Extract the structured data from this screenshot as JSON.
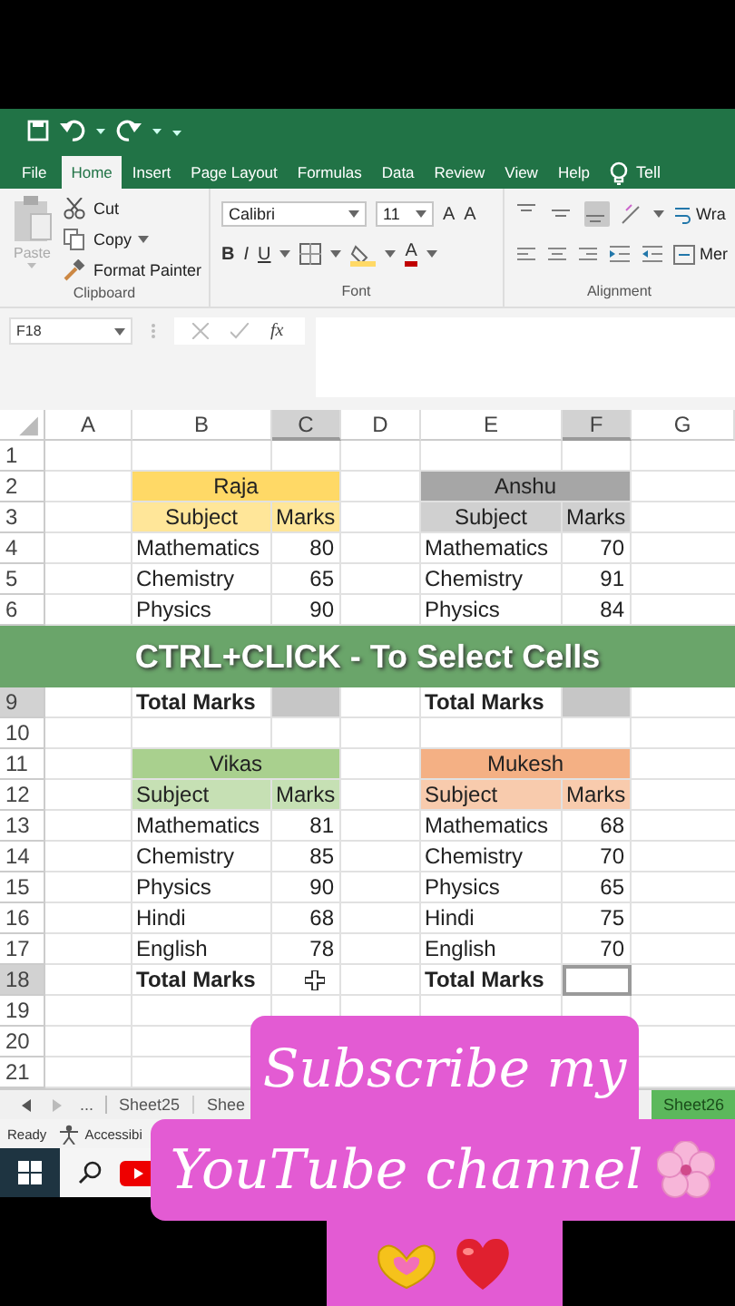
{
  "ribbon_tabs": [
    {
      "label": "File",
      "selected": false
    },
    {
      "label": "Home",
      "selected": true
    },
    {
      "label": "Insert",
      "selected": false
    },
    {
      "label": "Page Layout",
      "selected": false
    },
    {
      "label": "Formulas",
      "selected": false
    },
    {
      "label": "Data",
      "selected": false
    },
    {
      "label": "Review",
      "selected": false
    },
    {
      "label": "View",
      "selected": false
    },
    {
      "label": "Help",
      "selected": false
    }
  ],
  "tell_me": "Tell",
  "clipboard": {
    "paste": {
      "label": "Paste",
      "disabled": true
    },
    "cut": "Cut",
    "copy": "Copy",
    "format_painter": "Format Painter",
    "group": "Clipboard"
  },
  "font": {
    "name": "Calibri",
    "size": "11",
    "grow": "A",
    "shrink": "A",
    "bold": "B",
    "italic": "I",
    "underline": "U",
    "color_button": "A",
    "group": "Font"
  },
  "alignment": {
    "vertical": [
      {
        "selected": false
      },
      {
        "selected": false
      },
      {
        "selected": true
      }
    ],
    "wrap": "Wra",
    "merge": "Mer",
    "group": "Alignment"
  },
  "name_box": "F18",
  "function_label": "fx",
  "columns": [
    {
      "label": "A",
      "selected": false
    },
    {
      "label": "B",
      "selected": false
    },
    {
      "label": "C",
      "selected": true
    },
    {
      "label": "D",
      "selected": false
    },
    {
      "label": "E",
      "selected": false
    },
    {
      "label": "F",
      "selected": true
    },
    {
      "label": "G",
      "selected": false
    }
  ],
  "rows": [
    {
      "number": "1",
      "selected": false,
      "cells": [
        null,
        null,
        null,
        null,
        null,
        null,
        null
      ]
    },
    {
      "number": "2",
      "selected": false,
      "cells": [
        null,
        {
          "text": "Raja",
          "kind": "title",
          "color": "#ffd966"
        },
        null,
        null,
        {
          "text": "Anshu",
          "kind": "title",
          "color": "#a6a6a6"
        },
        null,
        null
      ]
    },
    {
      "number": "3",
      "selected": false,
      "cells": [
        null,
        {
          "text": "Subject",
          "kind": "header",
          "color": "#ffe699"
        },
        {
          "text": "Marks",
          "kind": "number",
          "color": "#ffe699"
        },
        null,
        {
          "text": "Subject",
          "kind": "header",
          "color": "#d0d0d0"
        },
        {
          "text": "Marks",
          "kind": "number",
          "color": "#d0d0d0"
        },
        null
      ]
    },
    {
      "number": "4",
      "selected": false,
      "cells": [
        null,
        {
          "text": "Mathematics",
          "kind": "label"
        },
        {
          "text": "80",
          "kind": "number"
        },
        null,
        {
          "text": "Mathematics",
          "kind": "label"
        },
        {
          "text": "70",
          "kind": "number"
        },
        null
      ]
    },
    {
      "number": "5",
      "selected": false,
      "cells": [
        null,
        {
          "text": "Chemistry",
          "kind": "label"
        },
        {
          "text": "65",
          "kind": "number"
        },
        null,
        {
          "text": "Chemistry",
          "kind": "label"
        },
        {
          "text": "91",
          "kind": "number"
        },
        null
      ]
    },
    {
      "number": "6",
      "selected": false,
      "cells": [
        null,
        {
          "text": "Physics",
          "kind": "label"
        },
        {
          "text": "90",
          "kind": "number"
        },
        null,
        {
          "text": "Physics",
          "kind": "label"
        },
        {
          "text": "84",
          "kind": "number"
        },
        null
      ]
    },
    {
      "kind": "banner",
      "text": "CTRL+CLICK - To Select Cells"
    },
    {
      "number": "9",
      "selected": true,
      "cells": [
        null,
        {
          "text": "Total Marks",
          "kind": "total"
        },
        {
          "selected": true
        },
        null,
        {
          "text": "Total Marks",
          "kind": "total"
        },
        {
          "selected": true
        },
        null
      ]
    },
    {
      "number": "10",
      "selected": false,
      "cells": [
        null,
        null,
        null,
        null,
        null,
        null,
        null
      ]
    },
    {
      "number": "11",
      "selected": false,
      "cells": [
        null,
        {
          "text": "Vikas",
          "kind": "title",
          "color": "#a9d08e"
        },
        null,
        null,
        {
          "text": "Mukesh",
          "kind": "title",
          "color": "#f4b084"
        },
        null,
        null
      ]
    },
    {
      "number": "12",
      "selected": false,
      "cells": [
        null,
        {
          "text": "Subject",
          "kind": "label",
          "color": "#c6e0b4"
        },
        {
          "text": "Marks",
          "kind": "number",
          "color": "#c6e0b4"
        },
        null,
        {
          "text": "Subject",
          "kind": "label",
          "color": "#f8cbad"
        },
        {
          "text": "Marks",
          "kind": "number",
          "color": "#f8cbad"
        },
        null
      ]
    },
    {
      "number": "13",
      "selected": false,
      "cells": [
        null,
        {
          "text": "Mathematics",
          "kind": "label"
        },
        {
          "text": "81",
          "kind": "number"
        },
        null,
        {
          "text": "Mathematics",
          "kind": "label"
        },
        {
          "text": "68",
          "kind": "number"
        },
        null
      ]
    },
    {
      "number": "14",
      "selected": false,
      "cells": [
        null,
        {
          "text": "Chemistry",
          "kind": "label"
        },
        {
          "text": "85",
          "kind": "number"
        },
        null,
        {
          "text": "Chemistry",
          "kind": "label"
        },
        {
          "text": "70",
          "kind": "number"
        },
        null
      ]
    },
    {
      "number": "15",
      "selected": false,
      "cells": [
        null,
        {
          "text": "Physics",
          "kind": "label"
        },
        {
          "text": "90",
          "kind": "number"
        },
        null,
        {
          "text": "Physics",
          "kind": "label"
        },
        {
          "text": "65",
          "kind": "number"
        },
        null
      ]
    },
    {
      "number": "16",
      "selected": false,
      "cells": [
        null,
        {
          "text": "Hindi",
          "kind": "label"
        },
        {
          "text": "68",
          "kind": "number"
        },
        null,
        {
          "text": "Hindi",
          "kind": "label"
        },
        {
          "text": "75",
          "kind": "number"
        },
        null
      ]
    },
    {
      "number": "17",
      "selected": false,
      "cells": [
        null,
        {
          "text": "English",
          "kind": "label"
        },
        {
          "text": "78",
          "kind": "number"
        },
        null,
        {
          "text": "English",
          "kind": "label"
        },
        {
          "text": "70",
          "kind": "number"
        },
        null
      ]
    },
    {
      "number": "18",
      "selected": true,
      "cells": [
        null,
        {
          "text": "Total Marks",
          "kind": "total"
        },
        {
          "selected": false,
          "pointer": true
        },
        null,
        {
          "text": "Total Marks",
          "kind": "total"
        },
        {
          "active": true
        },
        null
      ]
    },
    {
      "number": "19",
      "selected": false,
      "cells": [
        null,
        null,
        null,
        null,
        null,
        null,
        null
      ]
    },
    {
      "number": "20",
      "selected": false,
      "cells": [
        null,
        null,
        null,
        null,
        null,
        null,
        null
      ]
    },
    {
      "number": "21",
      "selected": false,
      "cells": [
        null,
        null,
        null,
        null,
        null,
        null,
        null
      ]
    }
  ],
  "sheet_tabs": {
    "more": "...",
    "tabs": [
      {
        "label": "Sheet25",
        "selected": false
      },
      {
        "label": "Shee",
        "selected": false
      },
      {
        "label": "Sheet26",
        "selected": true
      }
    ]
  },
  "status_bar": {
    "ready": "Ready",
    "accessibility": "Accessibi"
  },
  "sticker": {
    "lines": [
      "Subscribe my",
      "YouTube channel"
    ]
  }
}
